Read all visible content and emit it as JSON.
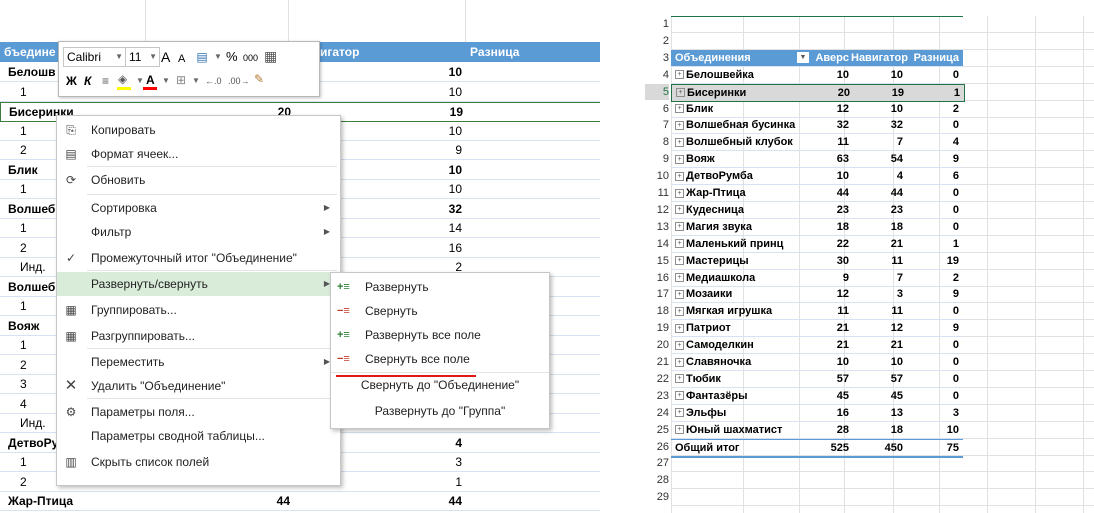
{
  "left": {
    "header": {
      "col1": "бъедине",
      "col2": "игатор",
      "col3": "Разница"
    },
    "rows": [
      {
        "label": "Белошв",
        "c3": "10",
        "bold": true
      },
      {
        "label": "1",
        "c3": "10",
        "bold": false
      },
      {
        "label": "Бисеринки",
        "c2": "20",
        "c3": "19",
        "bold": true
      },
      {
        "label": "1",
        "c3": "10",
        "bold": false
      },
      {
        "label": "2",
        "c3": "9",
        "bold": false
      },
      {
        "label": "Блик",
        "c3": "10",
        "bold": true
      },
      {
        "label": "1",
        "c3": "10",
        "bold": false
      },
      {
        "label": "Волшеб",
        "c3": "32",
        "bold": true
      },
      {
        "label": "1",
        "c3": "14",
        "bold": false
      },
      {
        "label": "2",
        "c3": "16",
        "bold": false
      },
      {
        "label": "Инд.",
        "c3": "2",
        "bold": false
      },
      {
        "label": "Волшеб",
        "c3": "",
        "bold": true
      },
      {
        "label": "1",
        "c3": "",
        "bold": false
      },
      {
        "label": "Вояж",
        "c3": "",
        "bold": true
      },
      {
        "label": "1",
        "c3": "",
        "bold": false
      },
      {
        "label": "2",
        "c3": "",
        "bold": false
      },
      {
        "label": "3",
        "c3": "",
        "bold": false
      },
      {
        "label": "4",
        "c3": "",
        "bold": false
      },
      {
        "label": "Инд.",
        "c3": "",
        "bold": false
      },
      {
        "label": "ДетвоРу",
        "c3": "4",
        "bold": true
      },
      {
        "label": "1",
        "c3": "3",
        "bold": false
      },
      {
        "label": "2",
        "c2": "4",
        "c3": "1",
        "bold": false
      },
      {
        "label": "Жар-Птица",
        "c2": "44",
        "c3": "44",
        "bold": true
      }
    ]
  },
  "minibar": {
    "font": "Calibri",
    "size": "11",
    "grow": "A",
    "shrink": "A",
    "percent": "%",
    "thousands": "000",
    "bold": "Ж",
    "italic": "К",
    "colors": {
      "fill": "#ffff00",
      "font": "#ff0000"
    }
  },
  "context_menu": {
    "items": [
      {
        "icon": "copy-icon",
        "label": "Копировать"
      },
      {
        "icon": "format-cells-icon",
        "label": "Формат ячеек..."
      },
      {
        "icon": "refresh-icon",
        "label": "Обновить"
      },
      {
        "icon": "",
        "label": "Сортировка"
      },
      {
        "icon": "",
        "label": "Фильтр"
      },
      {
        "icon": "check-icon",
        "label": "Промежуточный итог \"Объединение\""
      },
      {
        "icon": "",
        "label": "Развернуть/свернуть"
      },
      {
        "icon": "group-icon",
        "label": "Группировать..."
      },
      {
        "icon": "ungroup-icon",
        "label": "Разгруппировать..."
      },
      {
        "icon": "",
        "label": "Переместить"
      },
      {
        "icon": "delete-icon",
        "label": "Удалить \"Объединение\""
      },
      {
        "icon": "field-settings-icon",
        "label": "Параметры поля..."
      },
      {
        "icon": "",
        "label": "Параметры сводной таблицы..."
      },
      {
        "icon": "field-list-icon",
        "label": "Скрыть список полей"
      }
    ],
    "highlight_color": "#d9ecda"
  },
  "submenu": {
    "items": [
      {
        "label": "Развернуть"
      },
      {
        "label": "Свернуть"
      },
      {
        "label": "Развернуть все поле"
      },
      {
        "label": "Свернуть все поле"
      },
      {
        "label": "Свернуть до \"Объединение\""
      },
      {
        "label": "Развернуть до \"Группа\""
      }
    ]
  },
  "right": {
    "header": {
      "col1": "Объединения",
      "col2": "Аверс",
      "col3": "Навигатор",
      "col4": "Разница"
    },
    "rows": [
      {
        "name": "Белошвейка",
        "a": "10",
        "n": "10",
        "d": "0"
      },
      {
        "name": "Бисеринки",
        "a": "20",
        "n": "19",
        "d": "1"
      },
      {
        "name": "Блик",
        "a": "12",
        "n": "10",
        "d": "2"
      },
      {
        "name": "Волшебная бусинка",
        "a": "32",
        "n": "32",
        "d": "0"
      },
      {
        "name": "Волшебный клубок",
        "a": "11",
        "n": "7",
        "d": "4"
      },
      {
        "name": "Вояж",
        "a": "63",
        "n": "54",
        "d": "9"
      },
      {
        "name": "ДетвоРумба",
        "a": "10",
        "n": "4",
        "d": "6"
      },
      {
        "name": "Жар-Птица",
        "a": "44",
        "n": "44",
        "d": "0"
      },
      {
        "name": "Кудесница",
        "a": "23",
        "n": "23",
        "d": "0"
      },
      {
        "name": "Магия звука",
        "a": "18",
        "n": "18",
        "d": "0"
      },
      {
        "name": "Маленький принц",
        "a": "22",
        "n": "21",
        "d": "1"
      },
      {
        "name": "Мастерицы",
        "a": "30",
        "n": "11",
        "d": "19"
      },
      {
        "name": "Медиашкола",
        "a": "9",
        "n": "7",
        "d": "2"
      },
      {
        "name": "Мозаики",
        "a": "12",
        "n": "3",
        "d": "9"
      },
      {
        "name": "Мягкая игрушка",
        "a": "11",
        "n": "11",
        "d": "0"
      },
      {
        "name": "Патриот",
        "a": "21",
        "n": "12",
        "d": "9"
      },
      {
        "name": "Самоделкин",
        "a": "21",
        "n": "21",
        "d": "0"
      },
      {
        "name": "Славяночка",
        "a": "10",
        "n": "10",
        "d": "0"
      },
      {
        "name": "Тюбик",
        "a": "57",
        "n": "57",
        "d": "0"
      },
      {
        "name": "Фантазёры",
        "a": "45",
        "n": "45",
        "d": "0"
      },
      {
        "name": "Эльфы",
        "a": "16",
        "n": "13",
        "d": "3"
      },
      {
        "name": "Юный шахматист",
        "a": "28",
        "n": "18",
        "d": "10"
      }
    ],
    "total": {
      "name": "Общий итог",
      "a": "525",
      "n": "450",
      "d": "75"
    },
    "row_numbers": [
      "1",
      "2",
      "3",
      "4",
      "5",
      "6",
      "7",
      "8",
      "9",
      "10",
      "11",
      "12",
      "13",
      "14",
      "15",
      "16",
      "17",
      "18",
      "19",
      "20",
      "21",
      "22",
      "23",
      "24",
      "25",
      "26",
      "27",
      "28",
      "29"
    ],
    "colors": {
      "header_bg": "#5b9bd5",
      "selected_bg": "#d9d9d9"
    }
  }
}
